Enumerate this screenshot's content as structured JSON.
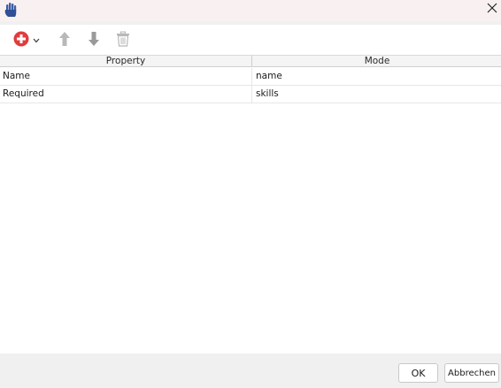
{
  "window": {
    "app_icon": "hand-icon",
    "close_icon": "close-icon"
  },
  "toolbar": {
    "add_icon": "plus-circle-icon",
    "add_menu_icon": "chevron-down-icon",
    "move_up_icon": "arrow-up-icon",
    "move_down_icon": "arrow-down-icon",
    "delete_icon": "trash-icon",
    "accent_color": "#e03c3c"
  },
  "table": {
    "columns": [
      "Property",
      "Mode"
    ],
    "rows": [
      {
        "property": "Name",
        "mode": "name"
      },
      {
        "property": "Required",
        "mode": "skills"
      }
    ]
  },
  "footer": {
    "ok_label": "OK",
    "cancel_label": "Abbrechen"
  }
}
